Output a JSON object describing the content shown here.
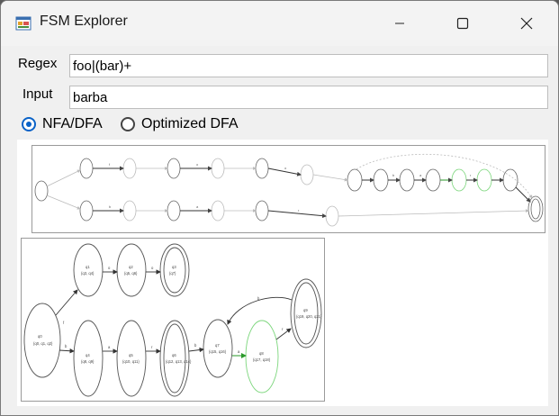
{
  "window": {
    "title": "FSM Explorer",
    "icon": "app-forms-icon",
    "controls": [
      "minimize-icon",
      "maximize-icon",
      "close-icon"
    ]
  },
  "form": {
    "regex_label": "Regex",
    "regex_value": "foo|(bar)+",
    "input_label": "Input",
    "input_value": "barba"
  },
  "modes": {
    "nfa_dfa_label": "NFA/DFA",
    "optimized_dfa_label": "Optimized DFA",
    "selected": "NFA/DFA"
  },
  "colors": {
    "radio_selected": "#0a62c7",
    "highlight_state": "#7cd67c"
  },
  "nfa_diagram": {
    "transitions": [
      "f",
      "o",
      "o",
      "b",
      "a",
      "r",
      "b",
      "a",
      "r"
    ]
  },
  "dfa_diagram": {
    "states": [
      {
        "id": "q0",
        "set": "{q0, q1, q2}"
      },
      {
        "id": "q1",
        "set": "{q3, q4}"
      },
      {
        "id": "q2",
        "set": "{q5, q6}"
      },
      {
        "id": "q3",
        "set": "{q7}"
      },
      {
        "id": "q4",
        "set": "{q8, q9}"
      },
      {
        "id": "q5",
        "set": "{q10, q11}"
      },
      {
        "id": "q6",
        "set": "{q12, q13, q14}"
      },
      {
        "id": "q7",
        "set": "{q15, q16}"
      },
      {
        "id": "q8",
        "set": "{q17, q18}"
      },
      {
        "id": "q9",
        "set": "{q19, q20, q21}"
      }
    ],
    "transitions": [
      "f",
      "o",
      "o",
      "b",
      "a",
      "r",
      "b",
      "a",
      "r",
      "b"
    ]
  }
}
